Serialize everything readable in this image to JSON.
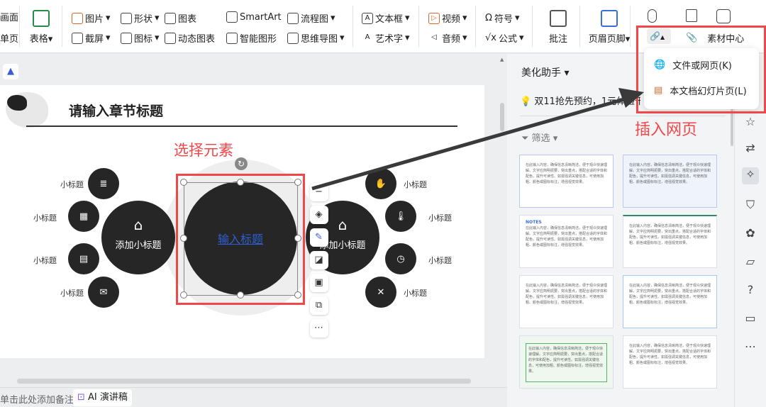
{
  "toolbar": {
    "partial_left": [
      "画面",
      "单页"
    ],
    "table": "表格",
    "picture": "图片",
    "shape": "形状",
    "chart": "图表",
    "smartart": "SmartArt",
    "flowchart": "流程图",
    "screenshot": "截屏",
    "icon": "图标",
    "dynamic_chart": "动态图表",
    "smart_graphic": "智能图形",
    "mindmap": "思维导图",
    "textbox": "文本框",
    "wordart": "艺术字",
    "video": "视频",
    "audio": "音频",
    "symbol": "符号",
    "formula": "公式",
    "comment": "批注",
    "header_footer": "页眉页脚",
    "material_center": "素材中心"
  },
  "hyperlink_menu": {
    "items": [
      "文件或网页(K)",
      "本文档幻灯片页(L)"
    ]
  },
  "annotations": {
    "insert_webpage": "插入网页",
    "select_element": "选择元素"
  },
  "slide": {
    "title": "请输入章节标题",
    "center_text": "输入标题",
    "left_sub": "添加小标题",
    "right_sub": "添加小标题",
    "small_label": "小标题"
  },
  "panel": {
    "title": "美化助手",
    "promo": "双11抢先预约，1元体验千元好",
    "filter": "筛选",
    "notes_label": "NOTES",
    "card_text": "在此输入内容，确保信息清晰简洁，便于观众快速理解。文字应简明扼要，突出重点，搭配合适的字体和配色，提升可读性。如需强调关键信息，可使用加粗、颜色或图标标注，增强视觉效果。"
  },
  "notes_bar": {
    "placeholder": "单击此处添加备注",
    "ai_button": "AI 演讲稿"
  },
  "colors": {
    "accent_red": "#f0474b",
    "dark_circle": "#262626",
    "link_blue": "#2d5fd3"
  }
}
